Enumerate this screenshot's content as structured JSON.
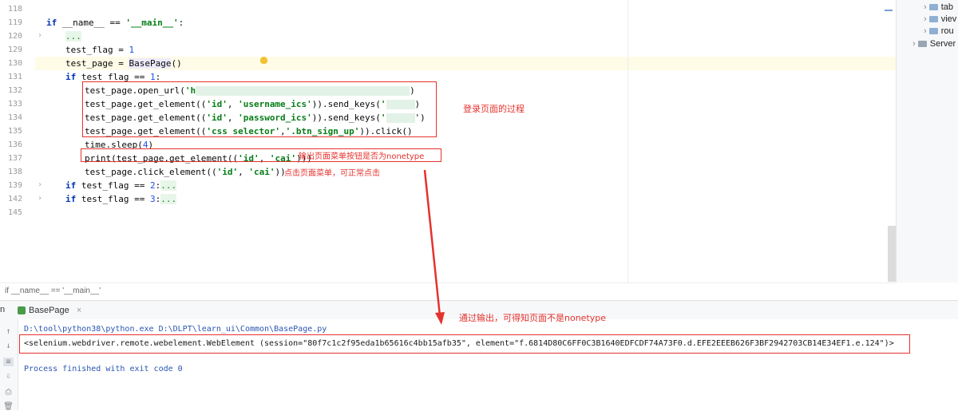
{
  "editor": {
    "line_numbers": [
      "118",
      "119",
      "120",
      "129",
      "130",
      "131",
      "132",
      "133",
      "134",
      "135",
      "136",
      "137",
      "138",
      "139",
      "142",
      "145"
    ],
    "lines": {
      "l119": {
        "kw": "if",
        "a": " __name__ == ",
        "str": "'__main__'",
        "b": ":"
      },
      "l120": {
        "dots": "..."
      },
      "l129": {
        "a": "test_flag = ",
        "num": "1"
      },
      "l130": {
        "a": "test_page = ",
        "fn": "BasePage",
        "b": "()"
      },
      "l131": {
        "kw": "if",
        "a": " test_flag == ",
        "num": "1",
        "b": ":"
      },
      "l132": {
        "a": "test_page.open_url(",
        "str": "'h",
        "b": ")"
      },
      "l133": {
        "a": "test_page.get_element((",
        "s1": "'id'",
        "m": ", ",
        "s2": "'username_ics'",
        "b": ")).send_keys(",
        "s3": "'",
        "c": ")"
      },
      "l134": {
        "a": "test_page.get_element((",
        "s1": "'id'",
        "m": ", ",
        "s2": "'password_ics'",
        "b": ")).send_keys(",
        "s3": "'",
        "c": "')"
      },
      "l135": {
        "a": "test_page.get_element((",
        "s1": "'css selector'",
        "m": ",",
        "s2": "'.btn_sign_up'",
        "b": ")).click()"
      },
      "l136": {
        "a": "time.sleep(",
        "num": "4",
        "b": ")"
      },
      "l137": {
        "kw": "print",
        "a": "(test_page.get_element((",
        "s1": "'id'",
        "m": ", ",
        "s2": "'cai'",
        "b": ")))"
      },
      "l138": {
        "a": "test_page.click_element((",
        "s1": "'id'",
        "m": ", ",
        "s2": "'cai'",
        "b": "))"
      },
      "l139": {
        "kw": "if",
        "a": " test_flag == ",
        "num": "2",
        "b": ":",
        "dots": "..."
      },
      "l142": {
        "kw": "if",
        "a": " test_flag == ",
        "num": "3",
        "b": ":",
        "dots": "..."
      }
    }
  },
  "right_panel": {
    "items": [
      {
        "label": "tab"
      },
      {
        "label": "viev"
      },
      {
        "label": "rou"
      },
      {
        "label": "Server"
      }
    ]
  },
  "breadcrumb": "if __name__ == '__main__'",
  "run_tab": {
    "prefix": "n",
    "label": "BasePage",
    "close": "×"
  },
  "console": {
    "command": "D:\\tool\\python38\\python.exe D:\\DLPT\\learn_ui\\Common\\BasePage.py",
    "output": "<selenium.webdriver.remote.webelement.WebElement (session=\"80f7c1c2f95eda1b65616c4bb15afb35\", element=\"f.6814D80C6FF0C3B1640EDFCDF74A73F0.d.EFE2EEEB626F3BF2942703CB14E34EF1.e.124\")>",
    "exit": "Process finished with exit code 0"
  },
  "annotations": {
    "login": "登录页面的过程",
    "print_check": "输出页面菜单按钮是否为nonetype",
    "click_note": "点击页面菜单，可正常点击",
    "result": "通过输出，可得知页面不是nonetype"
  },
  "colors": {
    "annotation": "#e5322d",
    "keyword": "#0033b3",
    "string": "#067d17",
    "number": "#1750eb"
  }
}
